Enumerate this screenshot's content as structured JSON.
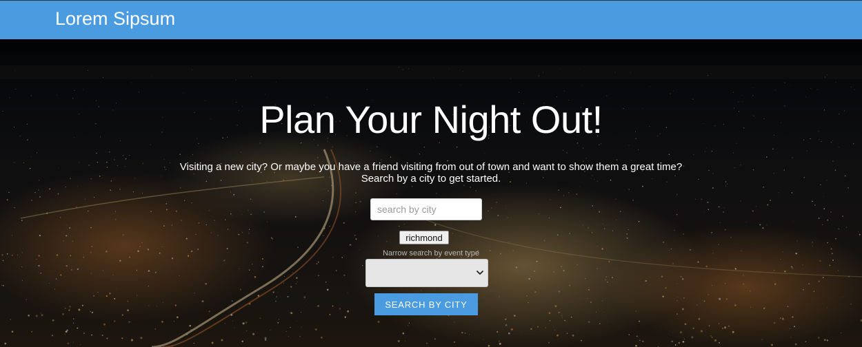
{
  "navbar": {
    "brand": "Lorem Sipsum",
    "background_color": "#4a9be0"
  },
  "hero": {
    "title": "Plan Your Night Out!",
    "intro_line_1": "Visiting a new city? Or maybe you have a friend visiting from out of town and want to show them a great time?",
    "intro_line_2": "Search by a city to get started."
  },
  "search": {
    "placeholder": "search by city",
    "value": "",
    "recent_city": "richmond",
    "event_type_label": "Narrow search by event type",
    "event_type_selected": "",
    "button_label": "SEARCH BY CITY",
    "button_color": "#4a9be0"
  },
  "icons": {
    "select_arrow": "chevron-down-icon"
  }
}
